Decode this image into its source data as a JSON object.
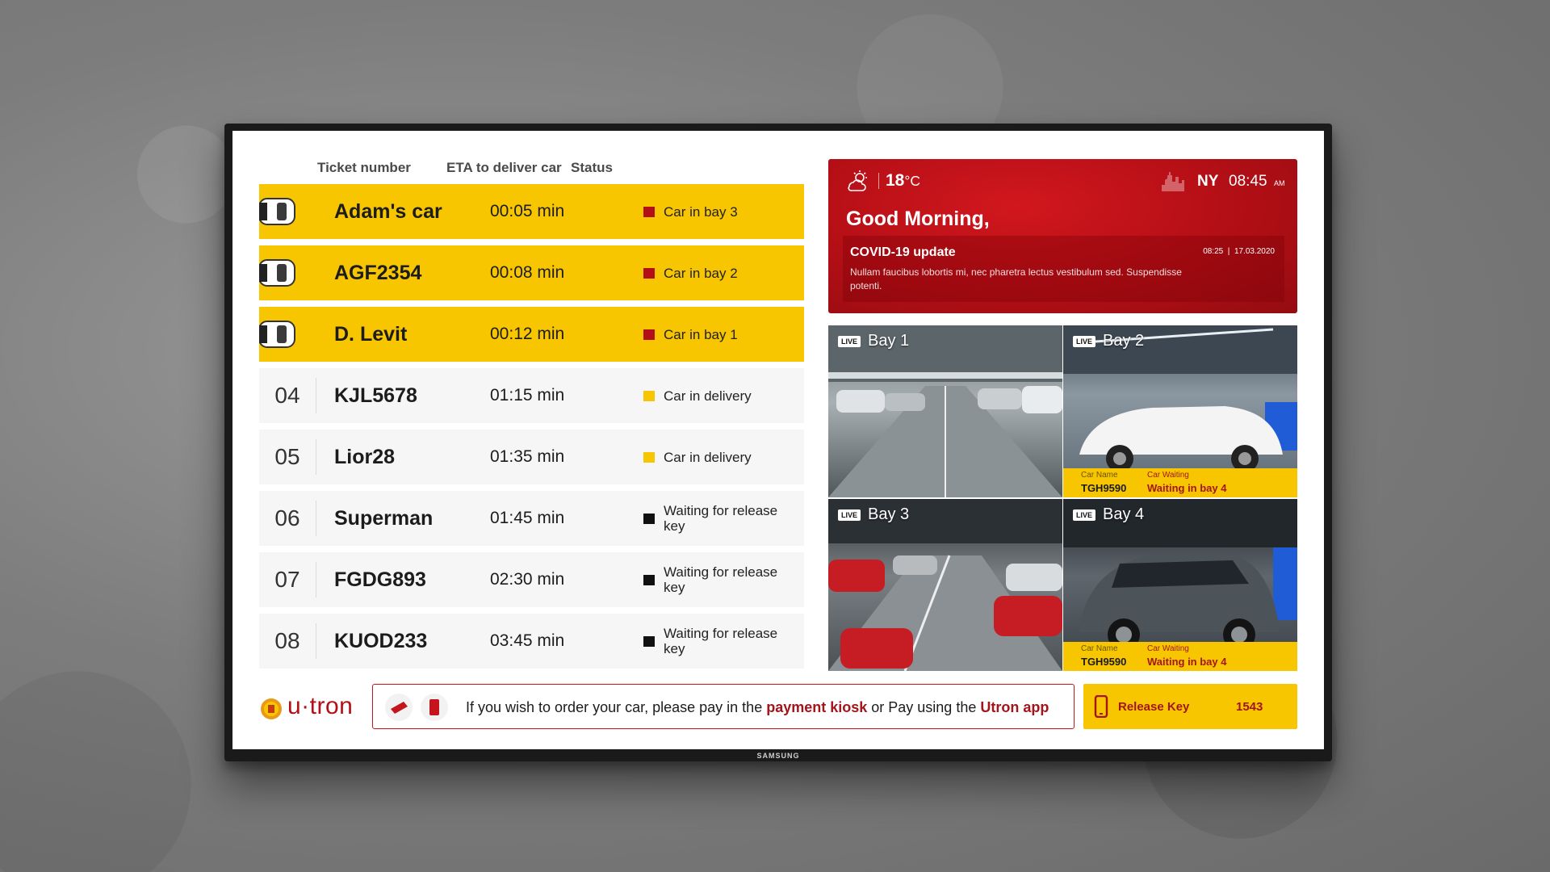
{
  "colors": {
    "accent_yellow": "#f7c600",
    "accent_red": "#b60f16",
    "row_bg": "#f6f6f6",
    "status_red": "#b30f16",
    "status_yellow": "#f7c600",
    "status_black": "#111111"
  },
  "table": {
    "headers": {
      "ticket": "Ticket number",
      "eta": "ETA to deliver car",
      "status": "Status"
    },
    "rows": [
      {
        "num": "",
        "name": "Adam's car",
        "eta": "00:05 min",
        "status": "Car in bay 3",
        "status_color": "red",
        "active": true
      },
      {
        "num": "",
        "name": "AGF2354",
        "eta": "00:08 min",
        "status": "Car in bay 2",
        "status_color": "red",
        "active": true
      },
      {
        "num": "",
        "name": "D. Levit",
        "eta": "00:12 min",
        "status": "Car in bay 1",
        "status_color": "red",
        "active": true
      },
      {
        "num": "04",
        "name": "KJL5678",
        "eta": "01:15 min",
        "status": "Car in delivery",
        "status_color": "yellow",
        "active": false
      },
      {
        "num": "05",
        "name": "Lior28",
        "eta": "01:35 min",
        "status": "Car in delivery",
        "status_color": "yellow",
        "active": false
      },
      {
        "num": "06",
        "name": "Superman",
        "eta": "01:45 min",
        "status": "Waiting for release key",
        "status_color": "black",
        "active": false
      },
      {
        "num": "07",
        "name": "FGDG893",
        "eta": "02:30 min",
        "status": "Waiting for release key",
        "status_color": "black",
        "active": false
      },
      {
        "num": "08",
        "name": "KUOD233",
        "eta": "03:45 min",
        "status": "Waiting for release key",
        "status_color": "black",
        "active": false
      }
    ]
  },
  "hero": {
    "temperature": "18",
    "temp_unit": "°C",
    "weather_icon": "partly-cloudy-sun-icon",
    "city_icon": "skyline-icon",
    "city": "NY",
    "time": "08:45",
    "ampm": "AM",
    "greeting": "Good Morning,",
    "news": {
      "title": "COVID-19 update",
      "time": "08:25",
      "date": "17.03.2020",
      "body": "Nullam faucibus lobortis mi, nec pharetra lectus vestibulum sed. Suspendisse potenti."
    }
  },
  "bays": [
    {
      "live": "LIVE",
      "title": "Bay 1",
      "info": null
    },
    {
      "live": "LIVE",
      "title": "Bay 2",
      "info": {
        "k1": "Car Name",
        "v1": "TGH9590",
        "k2": "Car Waiting",
        "v2": "Waiting in bay 4"
      }
    },
    {
      "live": "LIVE",
      "title": "Bay 3",
      "info": null
    },
    {
      "live": "LIVE",
      "title": "Bay 4",
      "info": {
        "k1": "Car Name",
        "v1": "TGH9590",
        "k2": "Car Waiting",
        "v2": "Waiting in bay 4"
      }
    }
  ],
  "footer": {
    "logo": "u·tron",
    "pay": {
      "prefix": "If you wish to order your car, please pay in the",
      "kiosk": "payment kiosk",
      "middle": "or Pay using the",
      "app": "Utron app"
    },
    "release_label": "Release Key",
    "release_code": "1543"
  },
  "tv_brand": "SAMSUNG"
}
